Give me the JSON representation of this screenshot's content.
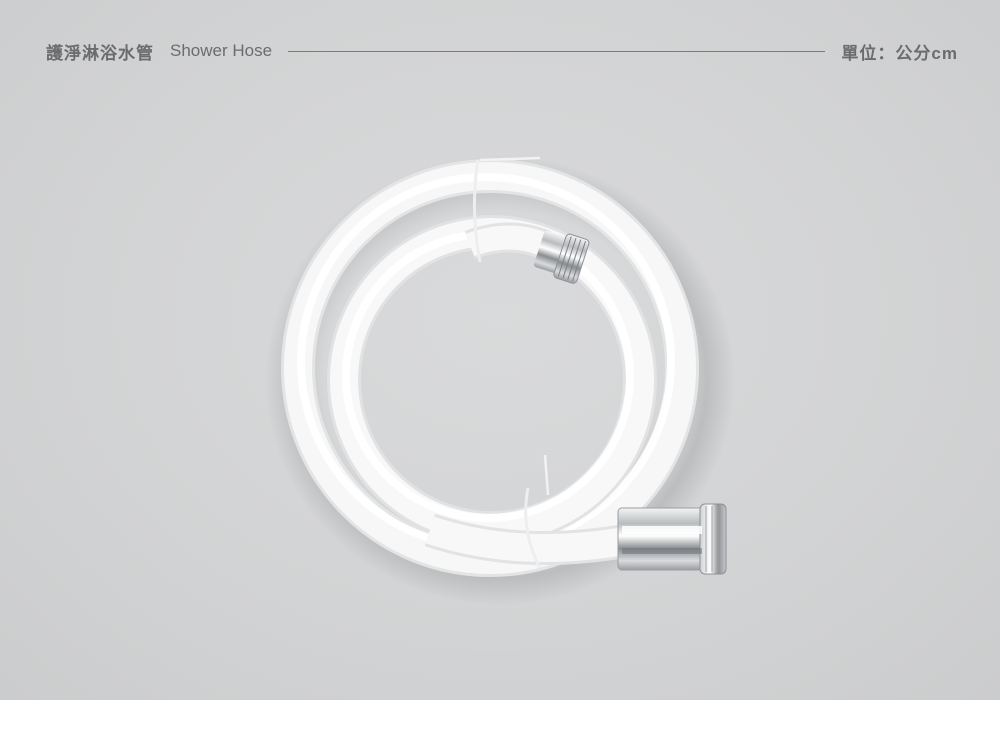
{
  "header": {
    "title_zh": "護淨淋浴水管",
    "title_en": "Shower Hose",
    "unit": "單位：公分cm"
  }
}
